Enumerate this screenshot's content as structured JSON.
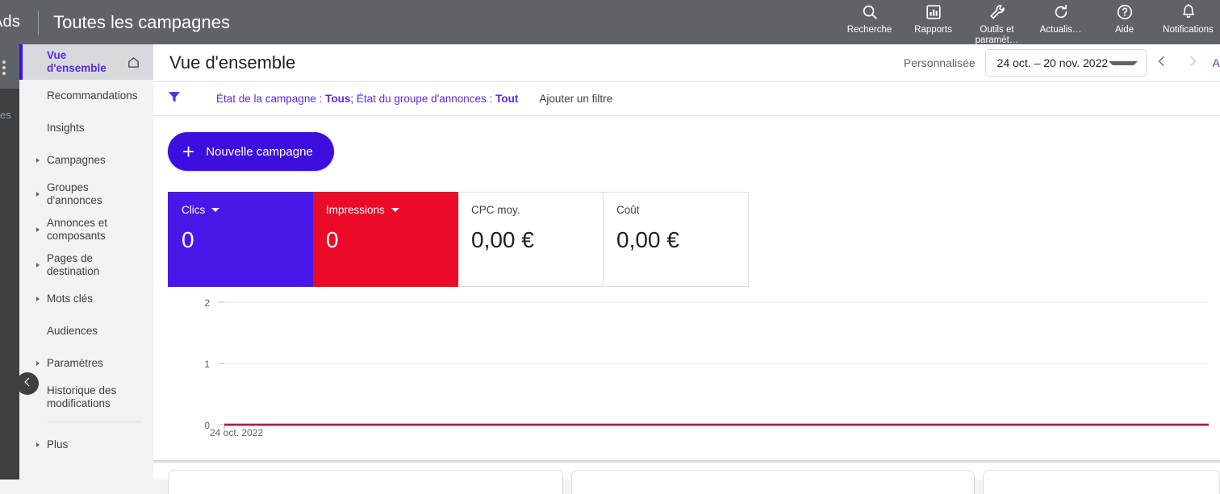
{
  "topbar": {
    "brand": "Ads",
    "scope": "Toutes les campagnes",
    "actions": [
      {
        "label": "Recherche",
        "icon": "search-icon"
      },
      {
        "label": "Rapports",
        "icon": "reports-bar-chart-icon"
      },
      {
        "label": "Outils et\nparamèt…",
        "icon": "wrench-tools-icon"
      },
      {
        "label": "Actualis…",
        "icon": "refresh-icon"
      },
      {
        "label": "Aide",
        "icon": "help-circle-icon"
      },
      {
        "label": "Notifications",
        "icon": "bell-icon"
      }
    ]
  },
  "account_rail": {
    "truncated_label": "es"
  },
  "sidebar": {
    "items": [
      {
        "label": "Vue d'ensemble",
        "expandable": false,
        "active": true,
        "trailing_icon": "home-icon"
      },
      {
        "label": "Recommandations",
        "expandable": false,
        "active": false
      },
      {
        "label": "Insights",
        "expandable": false,
        "active": false
      },
      {
        "label": "Campagnes",
        "expandable": true,
        "active": false
      },
      {
        "label": "Groupes d'annonces",
        "expandable": true,
        "active": false
      },
      {
        "label": "Annonces et composants",
        "expandable": true,
        "active": false
      },
      {
        "label": "Pages de destination",
        "expandable": true,
        "active": false
      },
      {
        "label": "Mots clés",
        "expandable": true,
        "active": false
      },
      {
        "label": "Audiences",
        "expandable": false,
        "active": false
      },
      {
        "label": "Paramètres",
        "expandable": true,
        "active": false
      },
      {
        "label": "Historique des modifications",
        "expandable": false,
        "active": false
      }
    ],
    "more_item": {
      "label": "Plus",
      "expandable": true
    },
    "collapse_icon": "chevron-left-icon"
  },
  "page": {
    "title": "Vue d'ensemble",
    "daterange": {
      "preset_label": "Personnalisée",
      "value": "24 oct. – 20 nov. 2022",
      "prev_icon": "chevron-left-icon",
      "next_icon": "chevron-right-icon",
      "more_label": "A"
    }
  },
  "filterbar": {
    "filter_icon": "filter-funnel-icon",
    "chip": {
      "key1": "État de la campagne : ",
      "val1": "Tous",
      "sep": "; ",
      "key2": "État du groupe d'annonces : ",
      "val2": "Tout"
    },
    "add_filter_label": "Ajouter un filtre"
  },
  "actions": {
    "new_campaign_label": "Nouvelle campagne",
    "new_campaign_icon": "plus-icon"
  },
  "metrics": [
    {
      "label": "Clics",
      "value": "0",
      "selected": "blue",
      "has_dropdown": true
    },
    {
      "label": "Impressions",
      "value": "0",
      "selected": "red",
      "has_dropdown": true
    },
    {
      "label": "CPC moy.",
      "value": "0,00 €",
      "selected": "none",
      "has_dropdown": false
    },
    {
      "label": "Coût",
      "value": "0,00 €",
      "selected": "none",
      "has_dropdown": false
    }
  ],
  "colors": {
    "brand_purple": "#3d0ee0",
    "link_purple": "#5b2be0",
    "metric_blue": "#4918E8",
    "metric_red": "#EB0A28",
    "topbar_gray": "#5f6368",
    "rail_dark": "#3c4043"
  },
  "chart_data": {
    "type": "line",
    "title": "",
    "xlabel": "",
    "ylabel": "",
    "ylim": [
      0,
      2
    ],
    "yticks": [
      "0",
      "1",
      "2"
    ],
    "xticks": [
      "24 oct. 2022"
    ],
    "grid": true,
    "legend": "none",
    "series": [
      {
        "name": "Clics",
        "color": "#4918E8",
        "values": [
          0,
          0
        ]
      },
      {
        "name": "Impressions",
        "color": "#C5003C",
        "values": [
          0,
          0
        ]
      }
    ]
  }
}
